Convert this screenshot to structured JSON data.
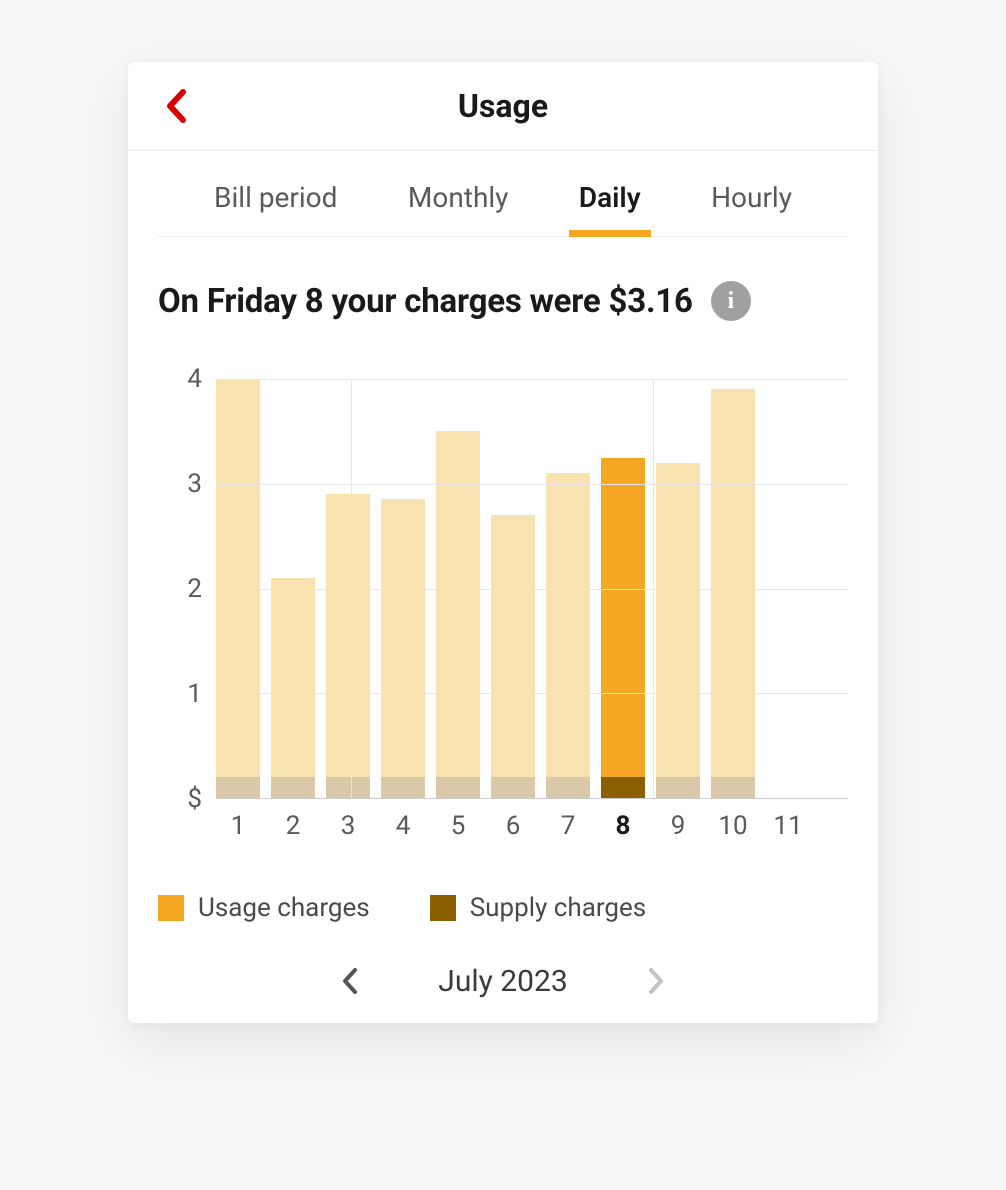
{
  "header": {
    "title": "Usage"
  },
  "tabs": [
    {
      "label": "Bill period",
      "active": false
    },
    {
      "label": "Monthly",
      "active": false
    },
    {
      "label": "Daily",
      "active": true
    },
    {
      "label": "Hourly",
      "active": false
    }
  ],
  "headline": "On Friday 8 your charges were $3.16",
  "legend": {
    "usage": "Usage charges",
    "supply": "Supply charges"
  },
  "period": {
    "label": "July 2023",
    "prev_enabled": true,
    "next_enabled": false
  },
  "chart_data": {
    "type": "bar",
    "title": "",
    "xlabel": "",
    "ylabel": "$",
    "ylim": [
      0,
      4
    ],
    "yticks": [
      1,
      2,
      3,
      4
    ],
    "categories": [
      "1",
      "2",
      "3",
      "4",
      "5",
      "6",
      "7",
      "8",
      "9",
      "10",
      "11"
    ],
    "selected_index": 7,
    "series": [
      {
        "name": "Usage charges",
        "values": [
          4.0,
          2.1,
          2.9,
          2.85,
          3.5,
          2.7,
          3.1,
          3.25,
          3.2,
          3.9,
          null
        ]
      },
      {
        "name": "Supply charges",
        "values": [
          0.2,
          0.2,
          0.2,
          0.2,
          0.2,
          0.2,
          0.2,
          0.2,
          0.2,
          0.2,
          null
        ]
      }
    ]
  },
  "colors": {
    "accent": "#f5a623",
    "accent_dark": "#8b5e00",
    "faded_bar": "#f8e2b0",
    "faded_supp": "#d9c9a8",
    "back_red": "#d80000"
  }
}
